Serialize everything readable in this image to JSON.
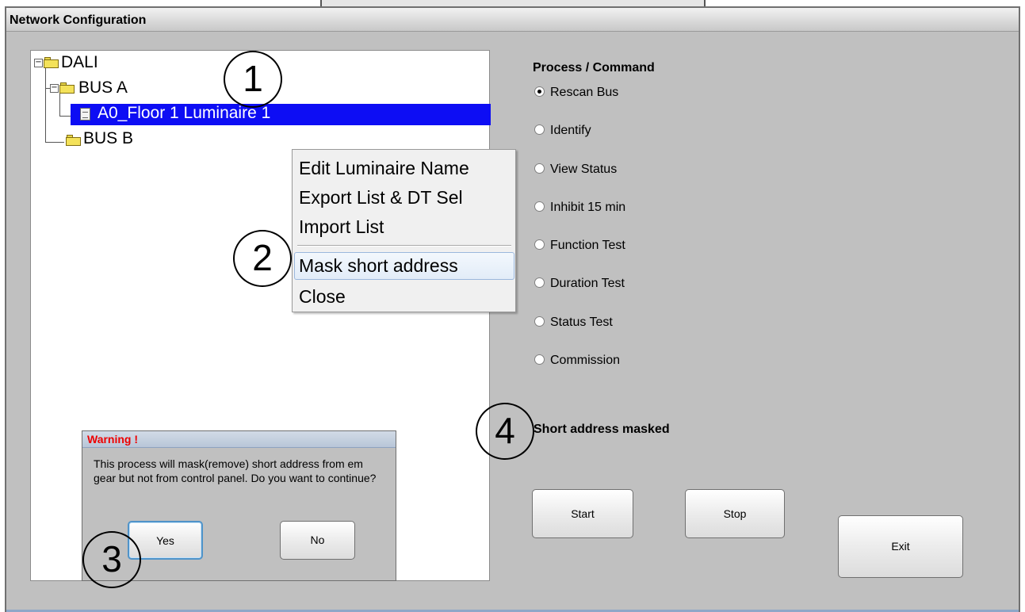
{
  "window": {
    "title": "Network Configuration"
  },
  "tree": {
    "root": "DALI",
    "bus_a": "BUS A",
    "luminaire": "A0_Floor 1 Luminaire 1",
    "bus_b": "BUS B"
  },
  "context_menu": {
    "items": [
      "Edit Luminaire Name",
      "Export List & DT Sel",
      "Import List",
      "Mask short address",
      "Close"
    ],
    "highlighted": "Mask short address"
  },
  "callouts": [
    "1",
    "2",
    "3",
    "4"
  ],
  "dialog": {
    "title": "Warning !",
    "message": "This process will mask(remove) short address from em gear but not from control panel. Do you want to continue?",
    "yes_label": "Yes",
    "no_label": "No"
  },
  "process": {
    "label": "Process / Command",
    "options": [
      "Rescan Bus",
      "Identify",
      "View Status",
      "Inhibit 15 min",
      "Function Test",
      "Duration Test",
      "Status Test",
      "Commission"
    ],
    "selected": "Rescan Bus"
  },
  "status": "Short address masked",
  "buttons": {
    "start": "Start",
    "stop": "Stop",
    "exit": "Exit"
  },
  "colors": {
    "selection": "#0d0df4",
    "warning_title": "#ee0000",
    "panel": "#c0c0c0"
  }
}
